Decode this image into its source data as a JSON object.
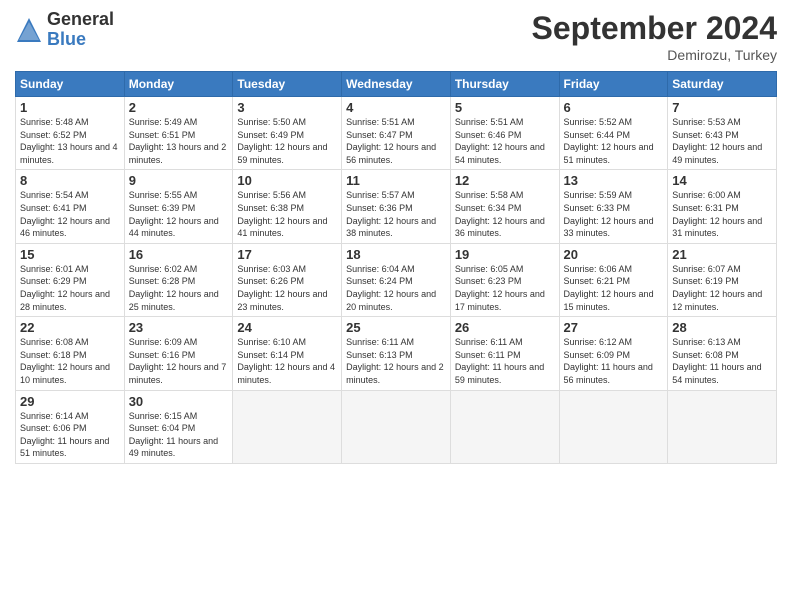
{
  "header": {
    "logo_general": "General",
    "logo_blue": "Blue",
    "month_title": "September 2024",
    "location": "Demirozu, Turkey"
  },
  "days_of_week": [
    "Sunday",
    "Monday",
    "Tuesday",
    "Wednesday",
    "Thursday",
    "Friday",
    "Saturday"
  ],
  "weeks": [
    [
      {
        "num": "1",
        "detail": "Sunrise: 5:48 AM\nSunset: 6:52 PM\nDaylight: 13 hours\nand 4 minutes."
      },
      {
        "num": "2",
        "detail": "Sunrise: 5:49 AM\nSunset: 6:51 PM\nDaylight: 13 hours\nand 2 minutes."
      },
      {
        "num": "3",
        "detail": "Sunrise: 5:50 AM\nSunset: 6:49 PM\nDaylight: 12 hours\nand 59 minutes."
      },
      {
        "num": "4",
        "detail": "Sunrise: 5:51 AM\nSunset: 6:47 PM\nDaylight: 12 hours\nand 56 minutes."
      },
      {
        "num": "5",
        "detail": "Sunrise: 5:51 AM\nSunset: 6:46 PM\nDaylight: 12 hours\nand 54 minutes."
      },
      {
        "num": "6",
        "detail": "Sunrise: 5:52 AM\nSunset: 6:44 PM\nDaylight: 12 hours\nand 51 minutes."
      },
      {
        "num": "7",
        "detail": "Sunrise: 5:53 AM\nSunset: 6:43 PM\nDaylight: 12 hours\nand 49 minutes."
      }
    ],
    [
      {
        "num": "8",
        "detail": "Sunrise: 5:54 AM\nSunset: 6:41 PM\nDaylight: 12 hours\nand 46 minutes."
      },
      {
        "num": "9",
        "detail": "Sunrise: 5:55 AM\nSunset: 6:39 PM\nDaylight: 12 hours\nand 44 minutes."
      },
      {
        "num": "10",
        "detail": "Sunrise: 5:56 AM\nSunset: 6:38 PM\nDaylight: 12 hours\nand 41 minutes."
      },
      {
        "num": "11",
        "detail": "Sunrise: 5:57 AM\nSunset: 6:36 PM\nDaylight: 12 hours\nand 38 minutes."
      },
      {
        "num": "12",
        "detail": "Sunrise: 5:58 AM\nSunset: 6:34 PM\nDaylight: 12 hours\nand 36 minutes."
      },
      {
        "num": "13",
        "detail": "Sunrise: 5:59 AM\nSunset: 6:33 PM\nDaylight: 12 hours\nand 33 minutes."
      },
      {
        "num": "14",
        "detail": "Sunrise: 6:00 AM\nSunset: 6:31 PM\nDaylight: 12 hours\nand 31 minutes."
      }
    ],
    [
      {
        "num": "15",
        "detail": "Sunrise: 6:01 AM\nSunset: 6:29 PM\nDaylight: 12 hours\nand 28 minutes."
      },
      {
        "num": "16",
        "detail": "Sunrise: 6:02 AM\nSunset: 6:28 PM\nDaylight: 12 hours\nand 25 minutes."
      },
      {
        "num": "17",
        "detail": "Sunrise: 6:03 AM\nSunset: 6:26 PM\nDaylight: 12 hours\nand 23 minutes."
      },
      {
        "num": "18",
        "detail": "Sunrise: 6:04 AM\nSunset: 6:24 PM\nDaylight: 12 hours\nand 20 minutes."
      },
      {
        "num": "19",
        "detail": "Sunrise: 6:05 AM\nSunset: 6:23 PM\nDaylight: 12 hours\nand 17 minutes."
      },
      {
        "num": "20",
        "detail": "Sunrise: 6:06 AM\nSunset: 6:21 PM\nDaylight: 12 hours\nand 15 minutes."
      },
      {
        "num": "21",
        "detail": "Sunrise: 6:07 AM\nSunset: 6:19 PM\nDaylight: 12 hours\nand 12 minutes."
      }
    ],
    [
      {
        "num": "22",
        "detail": "Sunrise: 6:08 AM\nSunset: 6:18 PM\nDaylight: 12 hours\nand 10 minutes."
      },
      {
        "num": "23",
        "detail": "Sunrise: 6:09 AM\nSunset: 6:16 PM\nDaylight: 12 hours\nand 7 minutes."
      },
      {
        "num": "24",
        "detail": "Sunrise: 6:10 AM\nSunset: 6:14 PM\nDaylight: 12 hours\nand 4 minutes."
      },
      {
        "num": "25",
        "detail": "Sunrise: 6:11 AM\nSunset: 6:13 PM\nDaylight: 12 hours\nand 2 minutes."
      },
      {
        "num": "26",
        "detail": "Sunrise: 6:11 AM\nSunset: 6:11 PM\nDaylight: 11 hours\nand 59 minutes."
      },
      {
        "num": "27",
        "detail": "Sunrise: 6:12 AM\nSunset: 6:09 PM\nDaylight: 11 hours\nand 56 minutes."
      },
      {
        "num": "28",
        "detail": "Sunrise: 6:13 AM\nSunset: 6:08 PM\nDaylight: 11 hours\nand 54 minutes."
      }
    ],
    [
      {
        "num": "29",
        "detail": "Sunrise: 6:14 AM\nSunset: 6:06 PM\nDaylight: 11 hours\nand 51 minutes."
      },
      {
        "num": "30",
        "detail": "Sunrise: 6:15 AM\nSunset: 6:04 PM\nDaylight: 11 hours\nand 49 minutes."
      },
      {
        "num": "",
        "detail": ""
      },
      {
        "num": "",
        "detail": ""
      },
      {
        "num": "",
        "detail": ""
      },
      {
        "num": "",
        "detail": ""
      },
      {
        "num": "",
        "detail": ""
      }
    ]
  ]
}
